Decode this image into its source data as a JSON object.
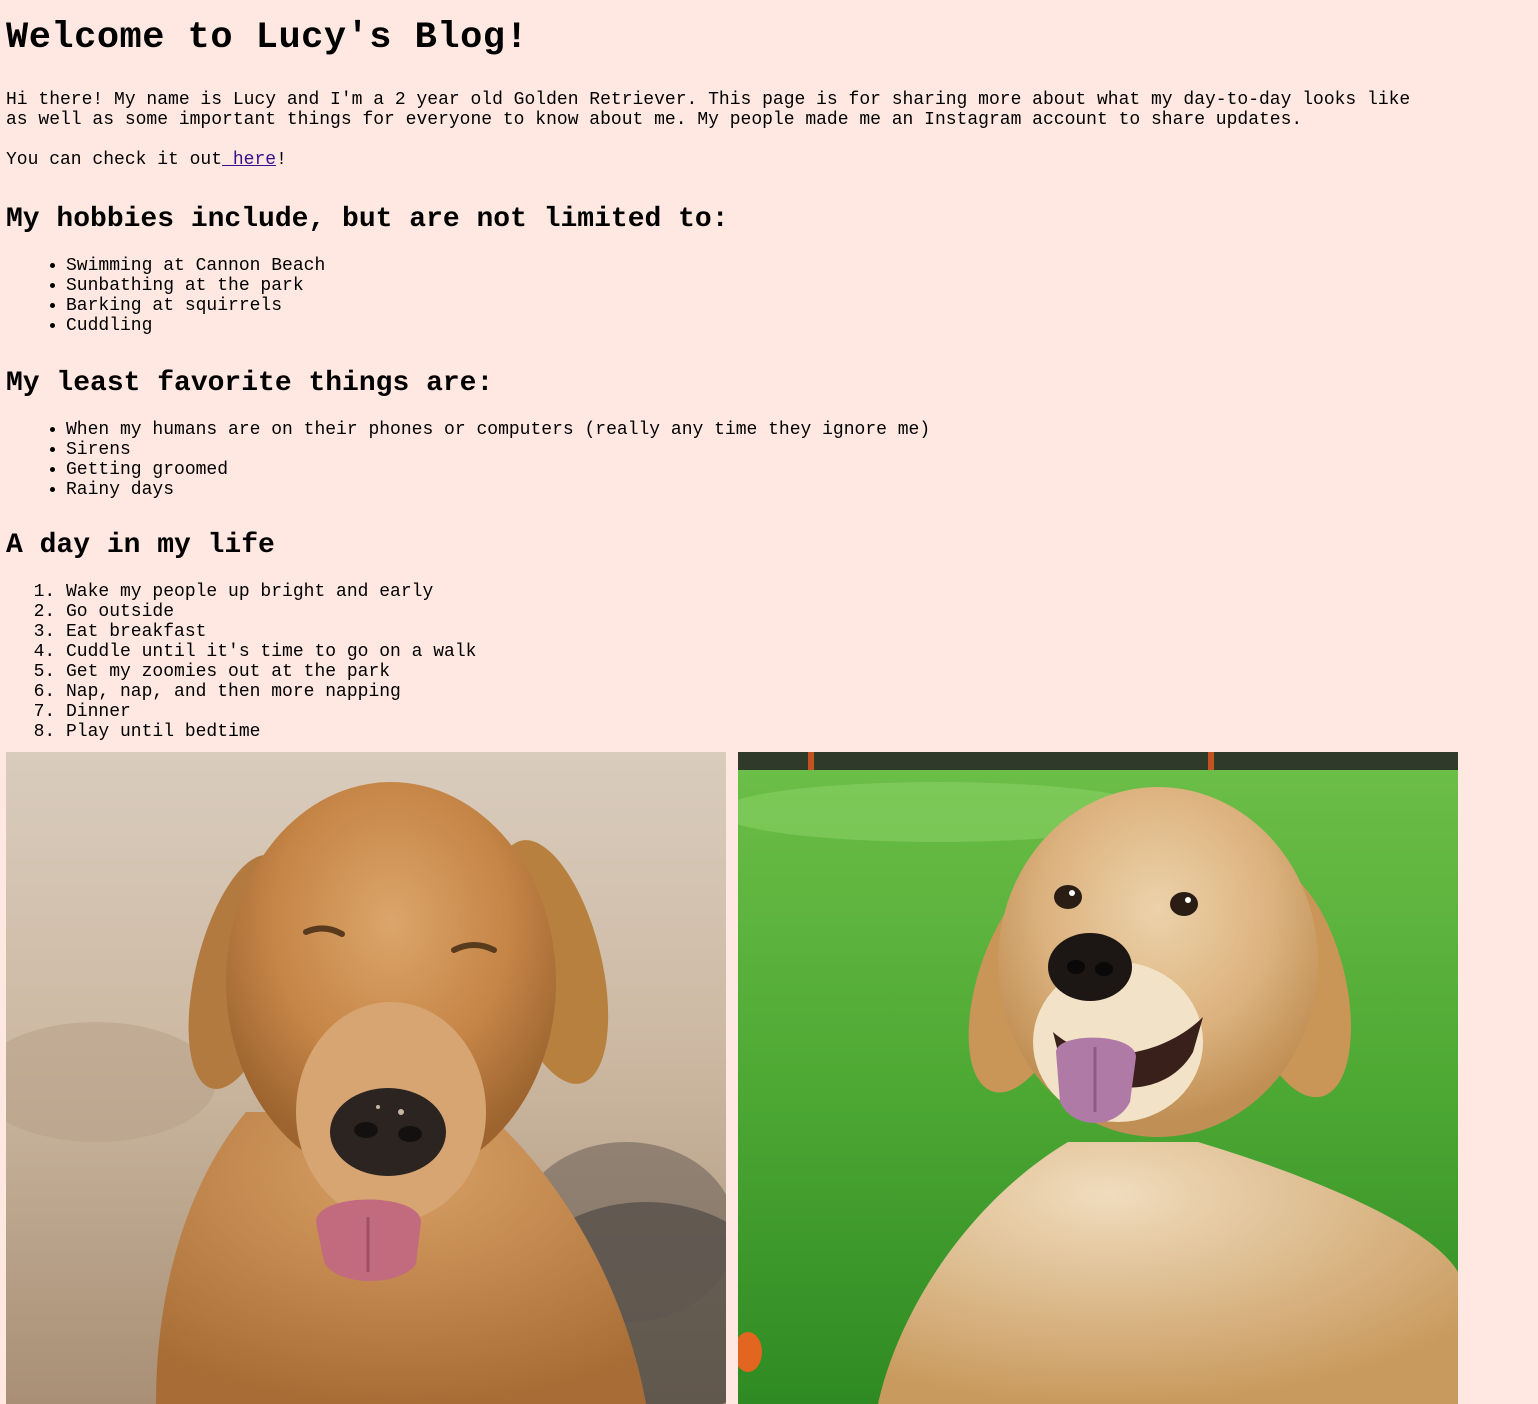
{
  "page": {
    "title": "Welcome to Lucy's Blog!",
    "intro_line_1": "Hi there! My name is Lucy and I'm a 2 year old Golden Retriever. This page is for sharing more about what my day-to-day looks like",
    "intro_line_2": "as well as some important things for everyone to know about me. My people made me an Instagram account to share updates.",
    "check_prefix": "You can check it out",
    "check_link": " here",
    "check_suffix": "!"
  },
  "hobbies": {
    "heading": "My hobbies include, but are not limited to:",
    "items": [
      "Swimming at Cannon Beach",
      "Sunbathing at the park",
      "Barking at squirrels",
      "Cuddling"
    ]
  },
  "least_favorite": {
    "heading": "My least favorite things are:",
    "items": [
      "When my humans are on their phones or computers (really any time they ignore me)",
      "Sirens",
      "Getting groomed",
      "Rainy days"
    ]
  },
  "day": {
    "heading": "A day in my life",
    "items": [
      "Wake my people up bright and early",
      "Go outside",
      "Eat breakfast",
      "Cuddle until it's time to go on a walk",
      "Get my zoomies out at the park",
      "Nap, nap, and then more napping",
      "Dinner",
      "Play until bedtime"
    ]
  },
  "colors": {
    "background": "#fee8e1",
    "link": "#3d0f8a"
  }
}
